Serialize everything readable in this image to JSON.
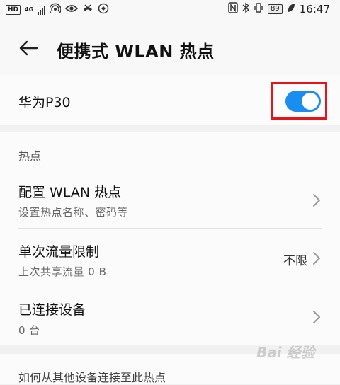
{
  "status_bar": {
    "hd": "HD",
    "network": "4G",
    "battery": "89",
    "time": "16:47"
  },
  "header": {
    "title": "便携式 WLAN 热点"
  },
  "hotspot": {
    "device_name": "华为P30",
    "enabled": true
  },
  "section": {
    "label": "热点",
    "rows": [
      {
        "title": "配置 WLAN 热点",
        "subtitle": "设置热点名称、密码等",
        "value": ""
      },
      {
        "title": "单次流量限制",
        "subtitle": "上次共享流量 0 B",
        "value": "不限"
      },
      {
        "title": "已连接设备",
        "subtitle": "0 台",
        "value": ""
      }
    ]
  },
  "footer": {
    "text": "如何从其他设备连接至此热点"
  },
  "colors": {
    "toggle_on": "#1a8eef",
    "highlight_frame": "#e5141b",
    "background": "#f1f1f1"
  }
}
